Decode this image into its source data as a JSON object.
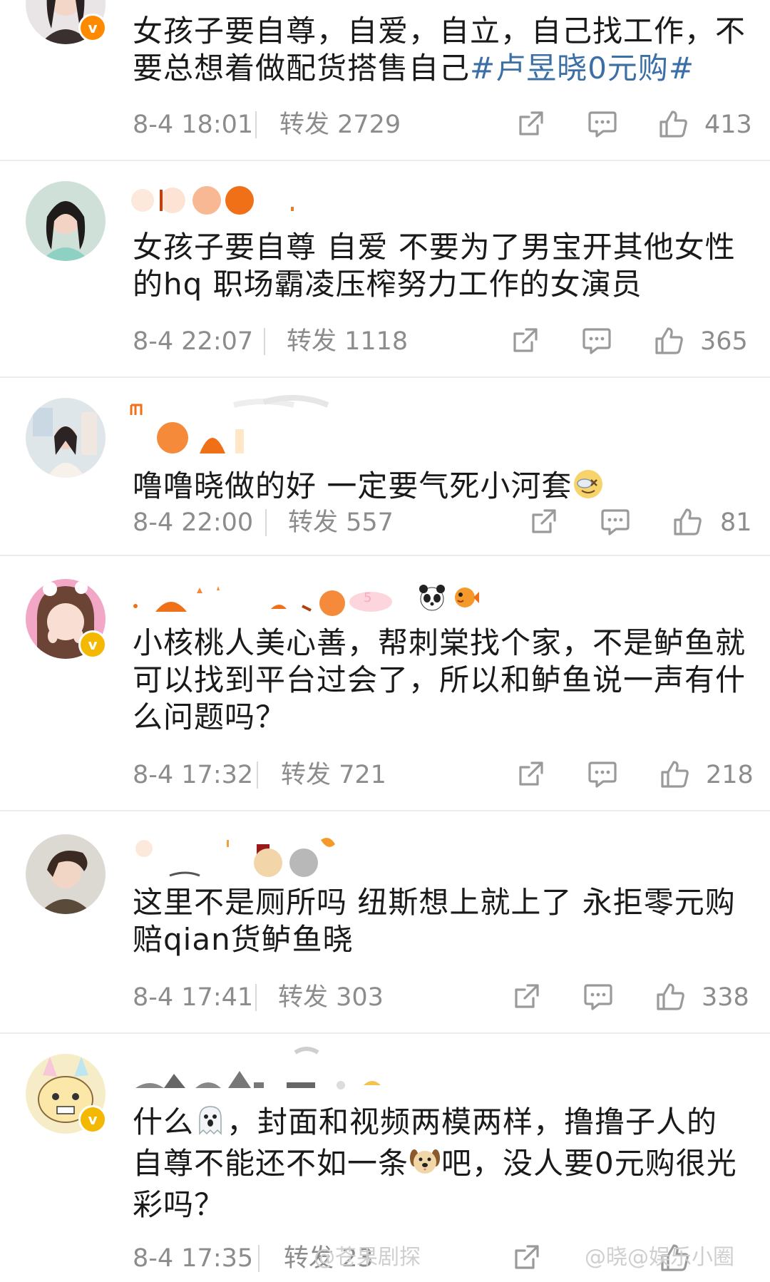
{
  "posts": [
    {
      "content_text": "女孩子要自尊，自爱，自立，自己找工作，不要总想着做配货搭售自己",
      "hashtag": "#卢昱晓0元购#",
      "time": "8-4 18:01",
      "repost": "转发 2729",
      "likes": "413",
      "verified": true
    },
    {
      "content_text": "女孩子要自尊 自爱 不要为了男宝开其他女性的hq 职场霸凌压榨努力工作的女演员",
      "time": "8-4 22:07",
      "repost": "转发 1118",
      "likes": "365",
      "verified": false
    },
    {
      "content_text": "噜噜晓做的好 一定要气死小河套",
      "time": "8-4 22:00",
      "repost": "转发 557",
      "likes": "81",
      "verified": false
    },
    {
      "content_text": "小核桃人美心善，帮刺棠找个家，不是鲈鱼就可以找到平台过会了，所以和鲈鱼说一声有什么问题吗？",
      "time": "8-4 17:32",
      "repost": "转发 721",
      "likes": "218",
      "verified": true
    },
    {
      "content_text": "这里不是厕所吗 纽斯想上就上了 永拒零元购赔qian货鲈鱼晓",
      "time": "8-4 17:41",
      "repost": "转发 303",
      "likes": "338",
      "verified": false
    },
    {
      "content_part1": "什么",
      "content_part2": "，封面和视频两模两样，撸撸子人的自尊不能还不如一条",
      "content_part3": "吧，没人要0元购很光彩吗？",
      "time": "8-4 17:35",
      "repost": "转发 23",
      "likes": "",
      "verified": true
    }
  ],
  "watermarks": {
    "left": "@苍果剧探",
    "right": "@晓@娱乐小圈"
  },
  "icons": {
    "share": "share-icon",
    "comment": "comment-icon",
    "like": "thumbs-up-icon"
  },
  "colors": {
    "hashtag": "#3b6fa6",
    "meta": "#8c8c8c",
    "verified": "#ff8a00"
  }
}
